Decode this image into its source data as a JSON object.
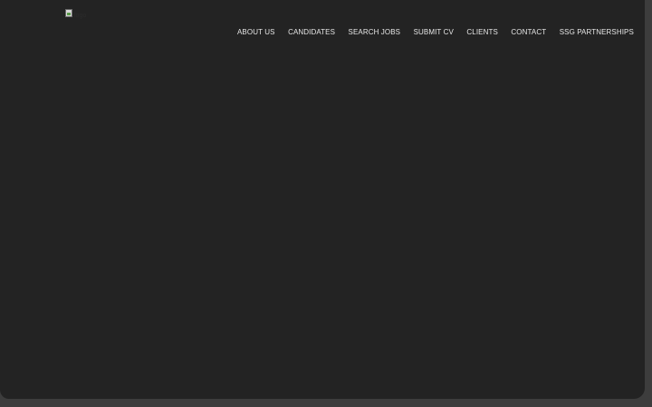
{
  "logo": {
    "alt_text": "logo",
    "icon": "broken-image-icon"
  },
  "nav": {
    "items": [
      {
        "label": "ABOUT US"
      },
      {
        "label": "CANDIDATES"
      },
      {
        "label": "SEARCH JOBS"
      },
      {
        "label": "SUBMIT CV"
      },
      {
        "label": "CLIENTS"
      },
      {
        "label": "CONTACT"
      },
      {
        "label": "SSG PARTNERSHIPS"
      }
    ]
  },
  "colors": {
    "hero_background": "#232323",
    "page_background": "#3d3d3d",
    "nav_text": "#e6e6e6"
  }
}
